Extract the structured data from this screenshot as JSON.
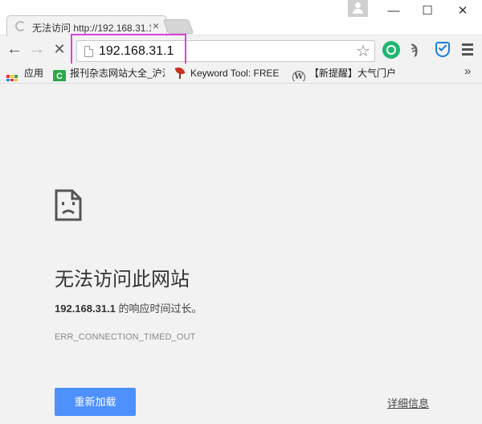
{
  "window": {
    "minimize_glyph": "—",
    "maximize_glyph": "☐",
    "close_glyph": "✕"
  },
  "tab": {
    "title": "无法访问 http://192.168.31.1",
    "close_glyph": "×"
  },
  "toolbar": {
    "back_glyph": "←",
    "forward_glyph": "→",
    "stop_glyph": "✕",
    "url": "192.168.31.1",
    "star_glyph": "☆"
  },
  "bookmarks": {
    "apps_label": "应用",
    "items": [
      {
        "label": "报刊杂志网站大全_沪江",
        "icon": "green-c-icon"
      },
      {
        "label": "Keyword Tool: FREE",
        "icon": "red-leaf-icon"
      },
      {
        "label": "【新提醒】大气门户",
        "icon": "wordpress-icon"
      }
    ],
    "more_glyph": "»"
  },
  "error_page": {
    "title": "无法访问此网站",
    "host": "192.168.31.1",
    "message_suffix": " 的响应时间过长。",
    "error_code": "ERR_CONNECTION_TIMED_OUT",
    "reload_label": "重新加载",
    "details_label": "详细信息"
  },
  "colors": {
    "accent_button": "#4d90fe",
    "highlight_box": "#e040e0"
  }
}
